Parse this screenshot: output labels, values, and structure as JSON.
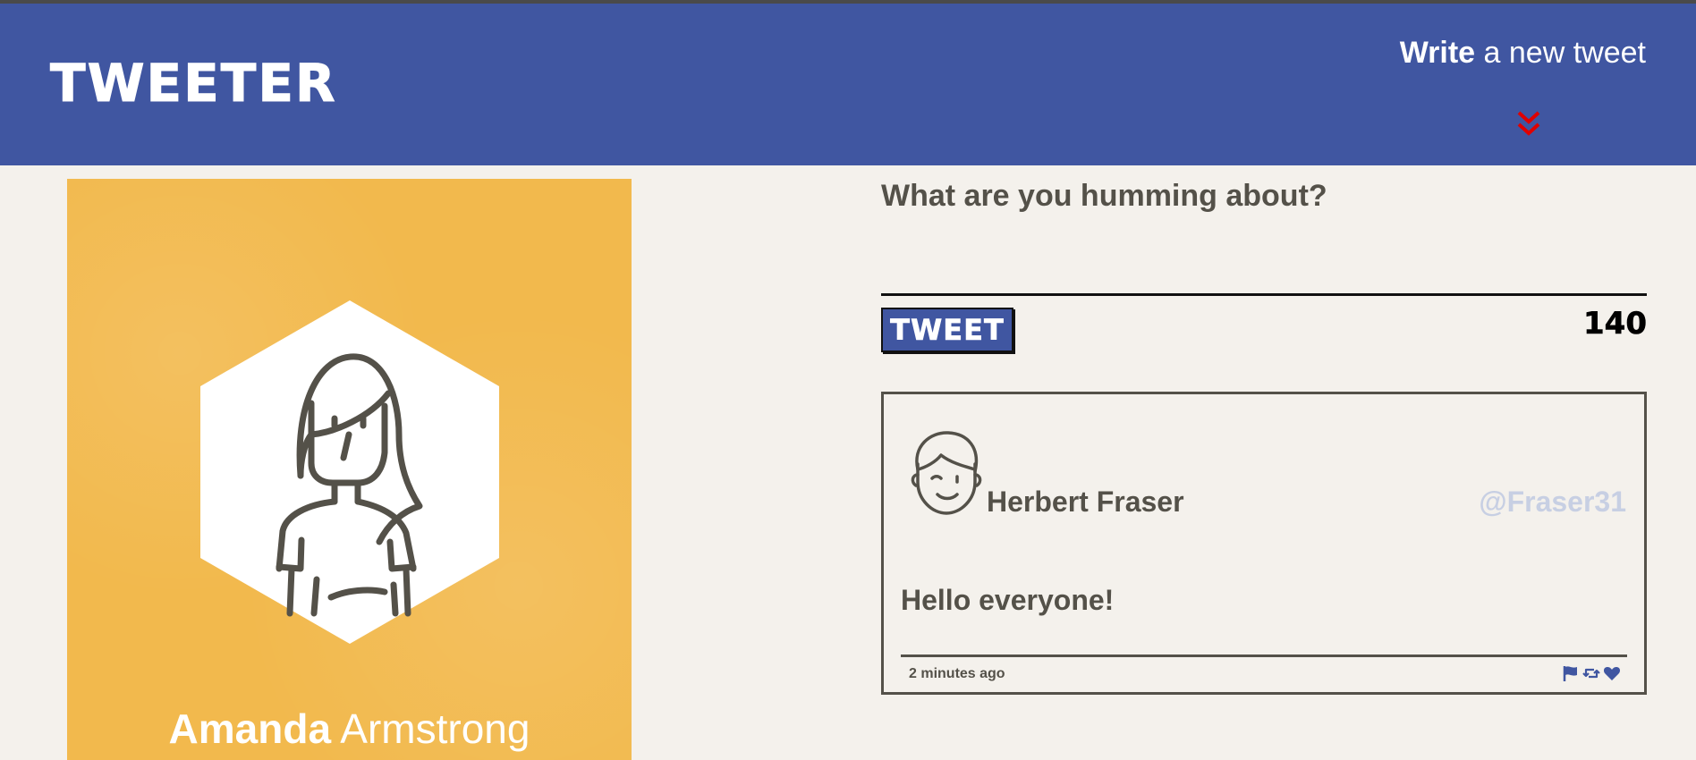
{
  "header": {
    "brand": "TWEETER",
    "compose_link": {
      "strong": "Write",
      "rest": "a new tweet"
    },
    "toggle_icon": "double-chevron-down-icon",
    "colors": {
      "nav_bg": "#4056a1",
      "chevron": "#e00000"
    }
  },
  "profile": {
    "first_name": "Amanda",
    "last_name": "Armstrong",
    "avatar_icon": "woman-avatar-icon",
    "colors": {
      "card_bg": "#f2b94d"
    }
  },
  "compose": {
    "prompt": "What are you humming about?",
    "submit_label": "TWEET",
    "counter": "140"
  },
  "tweets": [
    {
      "author": "Herbert Fraser",
      "handle": "@Fraser31",
      "avatar_icon": "man-avatar-icon",
      "content": "Hello everyone!",
      "time": "2 minutes ago",
      "actions": [
        "flag-icon",
        "retweet-icon",
        "heart-icon"
      ]
    }
  ],
  "colors": {
    "page_bg": "#f4f1ec",
    "text": "#545149",
    "handle": "#c7cfe3",
    "accent": "#4056a1"
  }
}
